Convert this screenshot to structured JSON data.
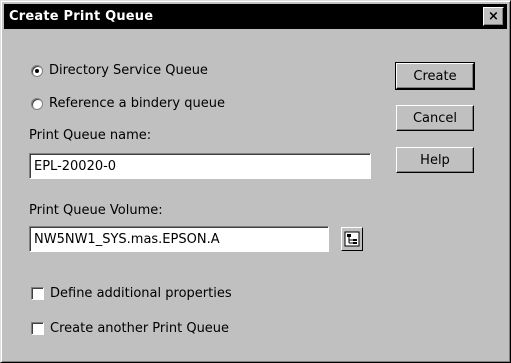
{
  "window": {
    "title": "Create Print Queue",
    "close_glyph": "×"
  },
  "options": {
    "directory_service_queue": {
      "label": "Directory Service Queue",
      "selected": true
    },
    "reference_bindery_queue": {
      "label": "Reference a bindery queue",
      "selected": false
    }
  },
  "fields": {
    "queue_name": {
      "label": "Print Queue name:",
      "value": "EPL-20020-0"
    },
    "queue_volume": {
      "label": "Print Queue Volume:",
      "value": "NW5NW1_SYS.mas.EPSON.A"
    }
  },
  "checkboxes": {
    "define_additional": {
      "label": "Define additional properties",
      "checked": false
    },
    "create_another": {
      "label": "Create another Print Queue",
      "checked": false
    }
  },
  "buttons": {
    "create": "Create",
    "cancel": "Cancel",
    "help": "Help"
  },
  "icons": {
    "browse": "browse-tree-icon",
    "close": "close-icon"
  }
}
